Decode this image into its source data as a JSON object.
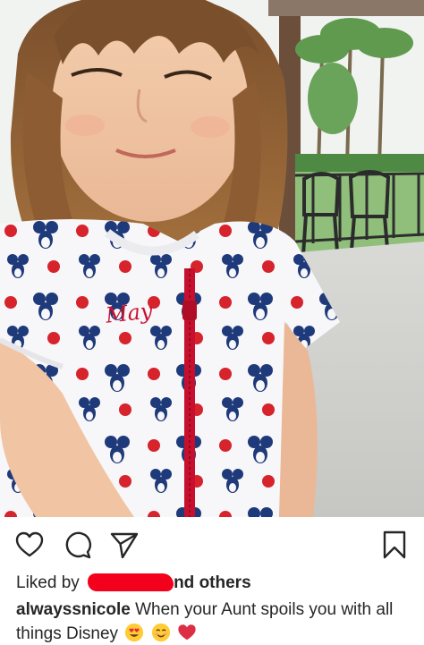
{
  "post": {
    "image_alt": "Photo of a young girl wearing a Minnie Mouse print romper with name embroidery",
    "embroidered_name": "May"
  },
  "actions": {
    "like_icon": "heart-outline-icon",
    "comment_icon": "comment-bubble-icon",
    "share_icon": "paper-plane-icon",
    "save_icon": "bookmark-outline-icon"
  },
  "likes": {
    "prefix": "Liked by",
    "suffix_partial": "nd",
    "others": "others"
  },
  "caption": {
    "username": "alwayssnicole",
    "text": "When your Aunt spoils you with all things Disney",
    "emojis": [
      "heart-eyes-emoji",
      "smiling-face-emoji",
      "red-heart-emoji"
    ]
  },
  "colors": {
    "text": "#262626",
    "redaction": "#f2001c",
    "romper_dot": "#d6232c",
    "zipper": "#c8102e",
    "minnie_blue": "#1f3a7a"
  }
}
